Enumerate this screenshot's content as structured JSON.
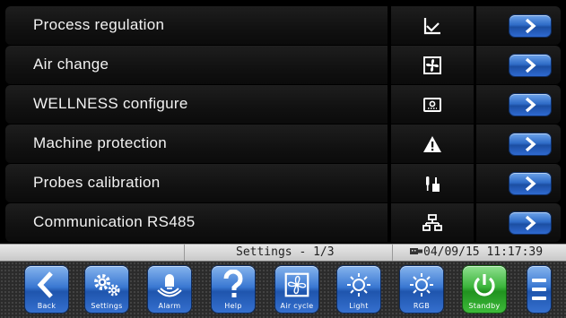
{
  "menu": {
    "items": [
      {
        "label": "Process regulation",
        "icon": "chart-line-icon",
        "action": "arrow-right-icon"
      },
      {
        "label": "Air change",
        "icon": "fan-icon",
        "action": "arrow-right-icon"
      },
      {
        "label": "WELLNESS configure",
        "icon": "wellness-panel-icon",
        "action": "arrow-right-icon"
      },
      {
        "label": "Machine protection",
        "icon": "warning-icon",
        "action": "arrow-right-icon"
      },
      {
        "label": "Probes calibration",
        "icon": "probe-icon",
        "action": "arrow-right-icon"
      },
      {
        "label": "Communication RS485",
        "icon": "network-icon",
        "action": "arrow-right-icon"
      }
    ]
  },
  "status": {
    "page": "Settings - 1/3",
    "datetime": "04/09/15 11:17:39",
    "usb_icon": "usb-icon"
  },
  "toolbar": {
    "buttons": [
      {
        "label": "Back",
        "icon": "back-icon"
      },
      {
        "label": "Settings",
        "icon": "gears-icon"
      },
      {
        "label": "Alarm",
        "icon": "alarm-icon"
      },
      {
        "label": "Help",
        "icon": "help-icon"
      },
      {
        "label": "Air cycle",
        "icon": "fan-icon"
      },
      {
        "label": "Light",
        "icon": "light-icon"
      },
      {
        "label": "RGB",
        "icon": "rgb-light-icon"
      },
      {
        "label": "Standby",
        "icon": "power-icon"
      }
    ],
    "menu_icon": "hamburger-menu-icon"
  },
  "colors": {
    "row_bg": "#111111",
    "accent_blue": "#2f6cc7",
    "standby_green": "#3bb43b",
    "status_bg": "#d8d8d8"
  }
}
